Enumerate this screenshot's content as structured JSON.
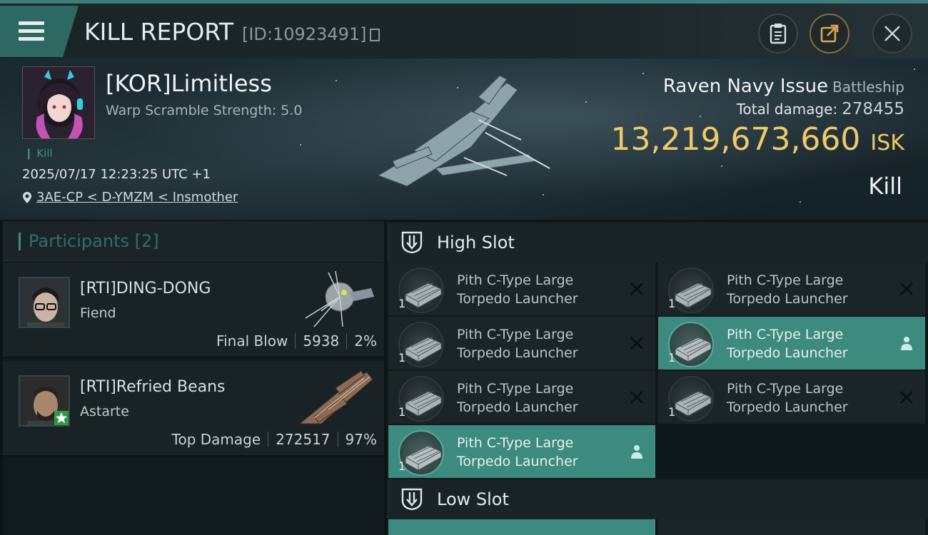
{
  "header": {
    "title": "KILL REPORT",
    "report_id": "[ID:10923491]",
    "icons": [
      "menu-icon",
      "copy-icon",
      "clipboard-icon",
      "share-icon",
      "close-icon"
    ]
  },
  "victim": {
    "pilot": "[KOR]Limitless",
    "warp_scramble": "Warp Scramble Strength: 5.0",
    "kill_tag": "Kill",
    "datetime": "2025/07/17 12:23:25 UTC +1",
    "location": "3AE-CP < D-YMZM < Insmother",
    "ship": "Raven Navy Issue",
    "ship_class": "Battleship",
    "total_damage_label": "Total damage:",
    "total_damage": "278455",
    "isk_value": "13,219,673,660",
    "isk_unit": "ISK",
    "result": "Kill"
  },
  "participants": {
    "label": "Participants",
    "count": "[2]",
    "list": [
      {
        "name": "[RTI]DING-DONG",
        "ship": "Fiend",
        "role": "Final Blow",
        "damage": "5938",
        "percent": "2%"
      },
      {
        "name": "[RTI]Refried Beans",
        "ship": "Astarte",
        "role": "Top Damage",
        "damage": "272517",
        "percent": "97%"
      }
    ]
  },
  "high_slot": {
    "title": "High Slot",
    "modules": [
      {
        "name": "Pith C-Type Large Torpedo Launcher",
        "qty": "1",
        "status": "destroyed"
      },
      {
        "name": "Pith C-Type Large Torpedo Launcher",
        "qty": "1",
        "status": "destroyed"
      },
      {
        "name": "Pith C-Type Large Torpedo Launcher",
        "qty": "1",
        "status": "destroyed"
      },
      {
        "name": "Pith C-Type Large Torpedo Launcher",
        "qty": "1",
        "status": "dropped"
      },
      {
        "name": "Pith C-Type Large Torpedo Launcher",
        "qty": "1",
        "status": "destroyed"
      },
      {
        "name": "Pith C-Type Large Torpedo Launcher",
        "qty": "1",
        "status": "destroyed"
      },
      {
        "name": "Pith C-Type Large Torpedo Launcher",
        "qty": "1",
        "status": "dropped"
      }
    ]
  },
  "low_slot": {
    "title": "Low Slot"
  },
  "colors": {
    "accent": "#3d8a7f",
    "isk": "#f0c96a",
    "panel": "#1b2528"
  }
}
